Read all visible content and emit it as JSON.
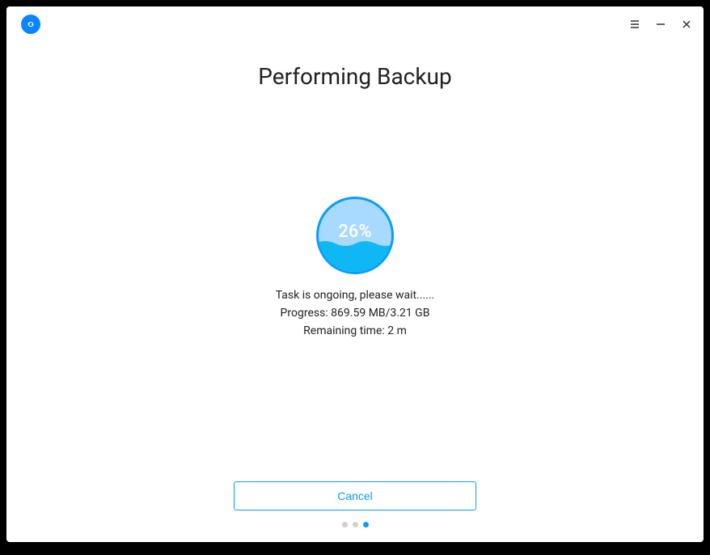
{
  "title": "Performing Backup",
  "progress": {
    "percent": "26%",
    "status": "Task is ongoing, please wait......",
    "progressLine": "Progress: 869.59 MB/3.21 GB",
    "remainingTime": "Remaining time: 2 m"
  },
  "buttons": {
    "cancel": "Cancel"
  },
  "colors": {
    "accent": "#0a9cff",
    "lightBlue": "#a8daff",
    "fillBlue": "#0fb7f5"
  },
  "pagination": {
    "totalDots": 3,
    "activeIndex": 2
  }
}
